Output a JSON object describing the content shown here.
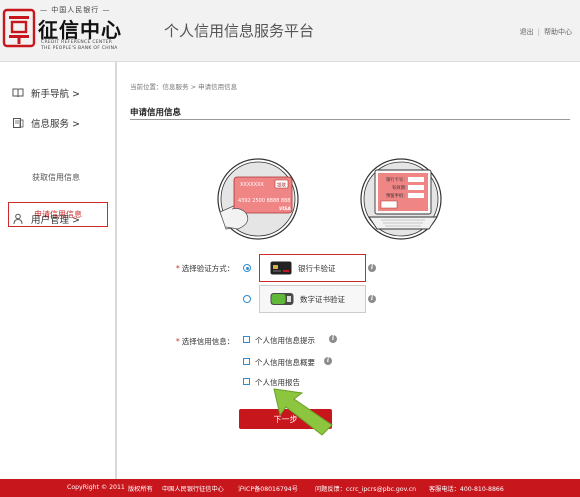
{
  "header": {
    "logo_top": "— 中国人民银行 —",
    "logo_name": "征信中心",
    "logo_en_line1": "CREDIT REFERENCE CENTER",
    "logo_en_line2": "THE PEOPLE'S BANK OF CHINA",
    "platform_title": "个人信用信息服务平台",
    "logout": "退出",
    "separator": "|",
    "help": "帮助中心"
  },
  "sidebar": {
    "items": [
      {
        "label": "新手导航 >",
        "icon": "book-icon"
      },
      {
        "label": "信息服务 >",
        "icon": "document-icon"
      },
      {
        "label": "用户管理 >",
        "icon": "user-icon"
      }
    ],
    "sub_items": [
      {
        "label": "申请信用信息",
        "active": true
      },
      {
        "label": "获取信用信息",
        "active": false
      }
    ]
  },
  "breadcrumb": "当前位置：信息服务 > 申请信用信息",
  "section_title": "申请信用信息",
  "illustration": {
    "card_brand": "XXXXXXX",
    "card_chip": "银联",
    "card_number": "4392 2500 8888 888",
    "card_network": "VISA",
    "form_line1": "银行卡号：",
    "form_line2": "有效期：",
    "form_line3": "预留手机："
  },
  "verify": {
    "label": "选择验证方式：",
    "required_mark": "*",
    "options": [
      {
        "label": "银行卡验证",
        "selected": true
      },
      {
        "label": "数字证书验证",
        "selected": false
      }
    ]
  },
  "credit": {
    "label": "选择信用信息：",
    "required_mark": "*",
    "options": [
      {
        "label": "个人信用信息提示"
      },
      {
        "label": "个人信用信息概要"
      },
      {
        "label": "个人信用报告"
      }
    ]
  },
  "next_button": "下一步",
  "info_glyph": "i",
  "footer": {
    "copyright": "CopyRight © 2011",
    "rights": "版权所有",
    "owner": "中国人民银行征信中心",
    "icp": "沪ICP备08016794号",
    "feedback": "问题反馈：ccrc_ipcrs@pbc.gov.cn",
    "phone": "客服电话：400-810-8866"
  },
  "colors": {
    "brand_red": "#c8161d",
    "accent_blue": "#2f8ccf",
    "arrow_green": "#8cc63f"
  }
}
